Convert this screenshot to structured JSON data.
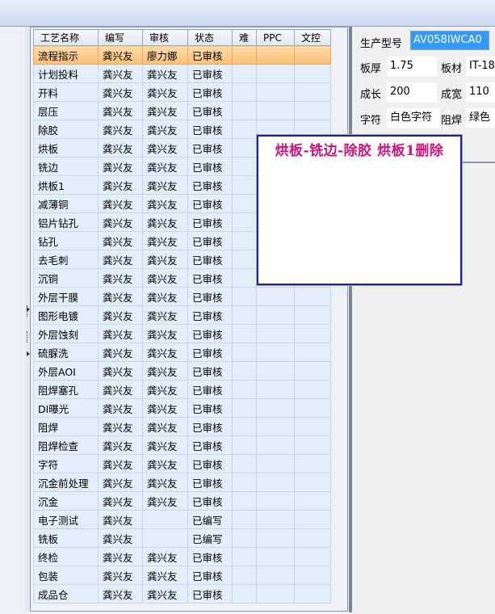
{
  "grid": {
    "columns": [
      "工艺名称",
      "编写",
      "审核",
      "状态",
      "难",
      "PPC",
      "文控"
    ],
    "rows": [
      {
        "name": "流程指示",
        "author": "龚兴友",
        "reviewer": "廖力娜",
        "status": "已审核",
        "selected": true
      },
      {
        "name": "计划投料",
        "author": "龚兴友",
        "reviewer": "龚兴友",
        "status": "已审核"
      },
      {
        "name": "开料",
        "author": "龚兴友",
        "reviewer": "龚兴友",
        "status": "已审核"
      },
      {
        "name": "层压",
        "author": "龚兴友",
        "reviewer": "龚兴友",
        "status": "已审核"
      },
      {
        "name": "除胶",
        "author": "龚兴友",
        "reviewer": "龚兴友",
        "status": "已审核"
      },
      {
        "name": "烘板",
        "author": "龚兴友",
        "reviewer": "龚兴友",
        "status": "已审核"
      },
      {
        "name": "铣边",
        "author": "龚兴友",
        "reviewer": "龚兴友",
        "status": "已审核"
      },
      {
        "name": "烘板1",
        "author": "龚兴友",
        "reviewer": "龚兴友",
        "status": "已审核"
      },
      {
        "name": "减薄铜",
        "author": "龚兴友",
        "reviewer": "龚兴友",
        "status": "已审核"
      },
      {
        "name": "铝片钻孔",
        "author": "龚兴友",
        "reviewer": "龚兴友",
        "status": "已审核"
      },
      {
        "name": "钻孔",
        "author": "龚兴友",
        "reviewer": "龚兴友",
        "status": "已审核"
      },
      {
        "name": "去毛刺",
        "author": "龚兴友",
        "reviewer": "龚兴友",
        "status": "已审核"
      },
      {
        "name": "沉铜",
        "author": "龚兴友",
        "reviewer": "龚兴友",
        "status": "已审核"
      },
      {
        "name": "外层干膜",
        "author": "龚兴友",
        "reviewer": "龚兴友",
        "status": "已审核"
      },
      {
        "name": "图形电镀",
        "author": "龚兴友",
        "reviewer": "龚兴友",
        "status": "已审核"
      },
      {
        "name": "外层蚀刻",
        "author": "龚兴友",
        "reviewer": "龚兴友",
        "status": "已审核"
      },
      {
        "name": "硫脲洗",
        "author": "龚兴友",
        "reviewer": "龚兴友",
        "status": "已审核"
      },
      {
        "name": "外层AOI",
        "author": "龚兴友",
        "reviewer": "龚兴友",
        "status": "已审核"
      },
      {
        "name": "阻焊塞孔",
        "author": "龚兴友",
        "reviewer": "龚兴友",
        "status": "已审核"
      },
      {
        "name": "DI曝光",
        "author": "龚兴友",
        "reviewer": "龚兴友",
        "status": "已审核"
      },
      {
        "name": "阻焊",
        "author": "龚兴友",
        "reviewer": "龚兴友",
        "status": "已审核"
      },
      {
        "name": "阻焊检查",
        "author": "龚兴友",
        "reviewer": "龚兴友",
        "status": "已审核"
      },
      {
        "name": "字符",
        "author": "龚兴友",
        "reviewer": "龚兴友",
        "status": "已审核"
      },
      {
        "name": "沉金前处理",
        "author": "龚兴友",
        "reviewer": "龚兴友",
        "status": "已审核"
      },
      {
        "name": "沉金",
        "author": "龚兴友",
        "reviewer": "龚兴友",
        "status": "已审核"
      },
      {
        "name": "电子测试",
        "author": "龚兴友",
        "reviewer": "",
        "status": "已编写"
      },
      {
        "name": "铣板",
        "author": "龚兴友",
        "reviewer": "",
        "status": "已编写"
      },
      {
        "name": "终检",
        "author": "龚兴友",
        "reviewer": "龚兴友",
        "status": "已审核"
      },
      {
        "name": "包装",
        "author": "龚兴友",
        "reviewer": "龚兴友",
        "status": "已审核"
      },
      {
        "name": "成品仓",
        "author": "龚兴友",
        "reviewer": "龚兴友",
        "status": "已审核"
      }
    ]
  },
  "popup": {
    "text": "烘板-铣边-除胶 烘板1删除"
  },
  "details": {
    "product_model_label": "生产型号",
    "product_model_value": "AV058IWCA0",
    "thickness_label": "板厚",
    "thickness_value": "1.75",
    "material_label": "板材",
    "material_value": "IT-18",
    "length_label": "成长",
    "length_value": "200",
    "width_label": "成宽",
    "width_value": "110",
    "char_label": "字符",
    "char_value": "白色字符",
    "mask_label": "阻焊",
    "mask_value": "绿色"
  }
}
